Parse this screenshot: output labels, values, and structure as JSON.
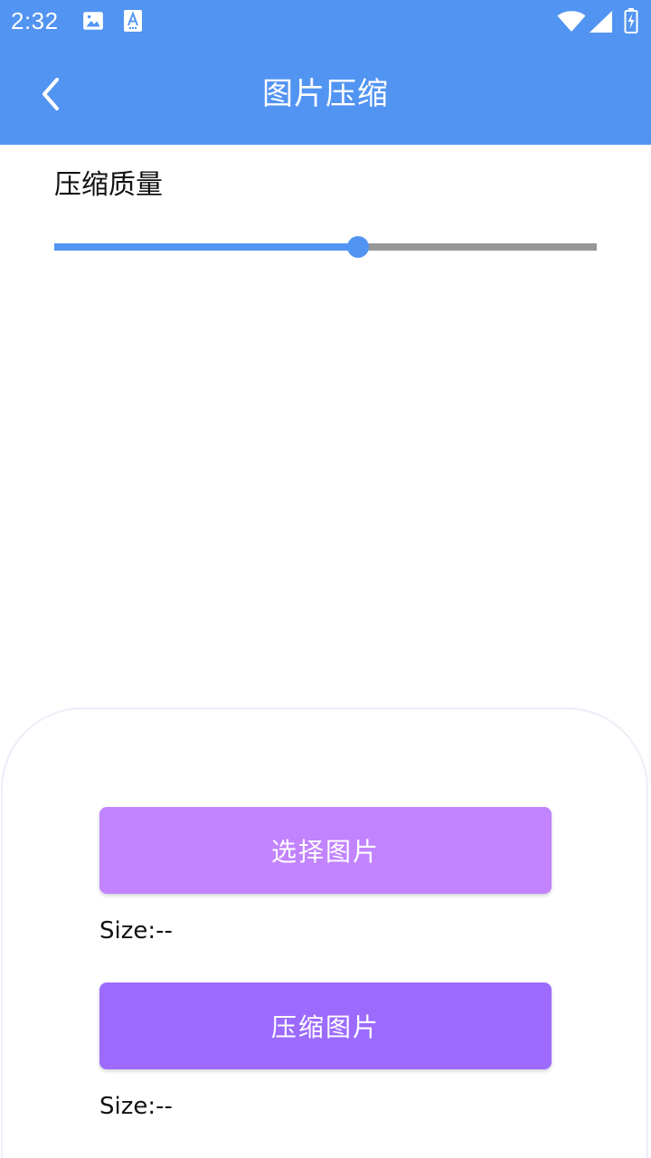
{
  "status_bar": {
    "time": "2:32",
    "icons": [
      "image-icon",
      "text-a-icon",
      "wifi-icon",
      "signal-icon",
      "battery-charging-icon"
    ]
  },
  "app_bar": {
    "title": "图片压缩",
    "back_icon": "chevron-left-icon"
  },
  "quality": {
    "label": "压缩质量",
    "value_fraction": 0.56
  },
  "actions": {
    "select_label": "选择图片",
    "select_size": "Size:--",
    "compress_label": "压缩图片",
    "compress_size": "Size:--"
  },
  "colors": {
    "primary": "#5294F2",
    "track": "#979797",
    "select_button": "#C283FF",
    "compress_button": "#9C6BFE"
  }
}
